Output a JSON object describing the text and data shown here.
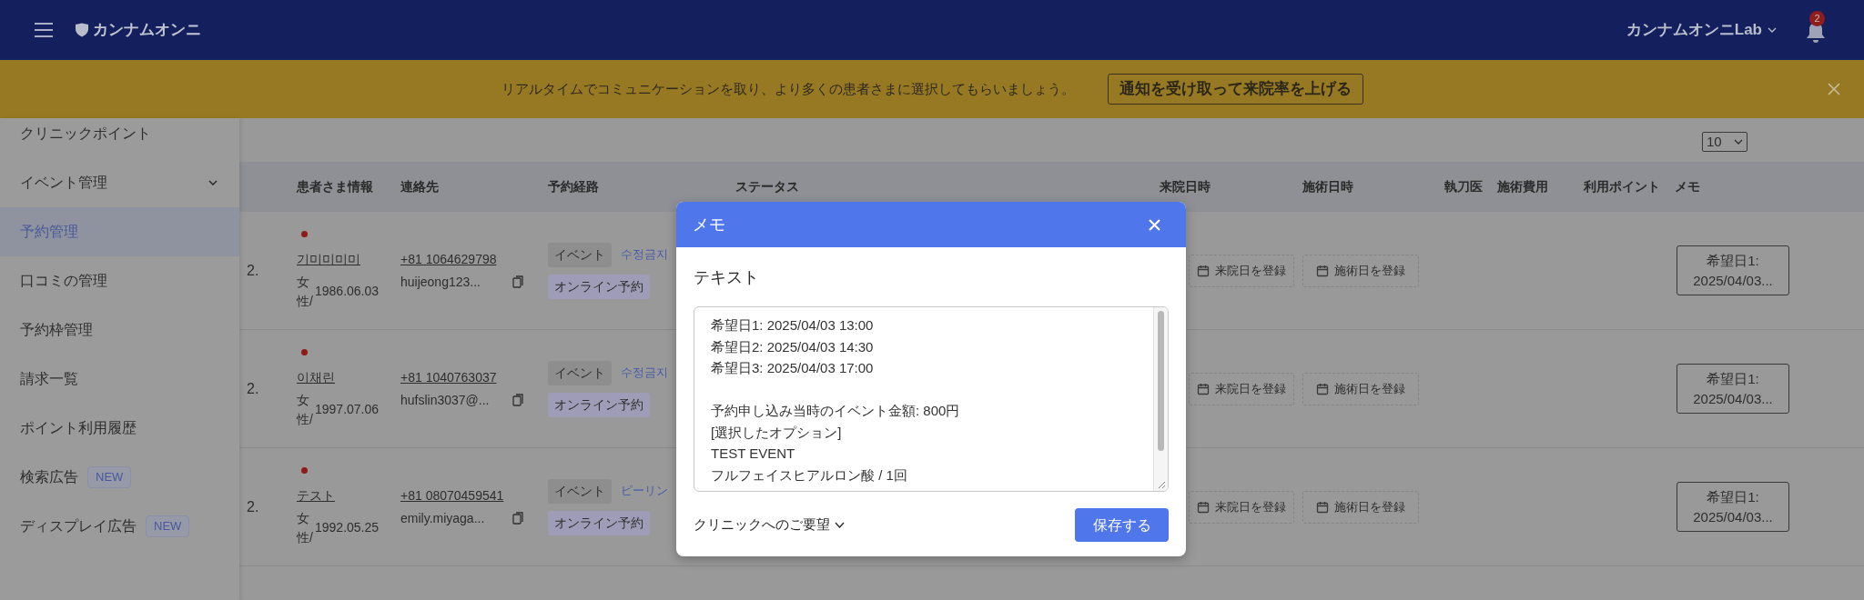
{
  "header": {
    "logo": "カンナムオンニ",
    "account": "カンナムオンニLab",
    "notification_count": "2"
  },
  "banner": {
    "message": "リアルタイムでコミュニケーションを取り、より多くの患者さまに選択してもらいましょう。",
    "button": "通知を受け取って来院率を上げる"
  },
  "sidebar": {
    "items": [
      {
        "label": "クリニックポイント",
        "kind": "link",
        "selected": false
      },
      {
        "label": "イベント管理",
        "kind": "group",
        "selected": false
      },
      {
        "label": "予約管理",
        "kind": "link",
        "selected": true
      },
      {
        "label": "口コミの管理",
        "kind": "link",
        "selected": false
      },
      {
        "label": "予約枠管理",
        "kind": "link",
        "selected": false
      },
      {
        "label": "請求一覧",
        "kind": "link",
        "selected": false
      },
      {
        "label": "ポイント利用履歴",
        "kind": "link",
        "selected": false
      },
      {
        "label": "検索広告",
        "kind": "link",
        "selected": false,
        "badge": "NEW"
      },
      {
        "label": "ディスプレイ広告",
        "kind": "link",
        "selected": false,
        "badge": "NEW"
      }
    ]
  },
  "page_size": "10",
  "table": {
    "columns": [
      "患者さま情報",
      "連絡先",
      "予約経路",
      "ステータス",
      "来院日時",
      "施術日時",
      "執刀医",
      "施術費用",
      "利用ポイント",
      "メモ"
    ],
    "rows": [
      {
        "column_1": "2.",
        "name": "기미미미미",
        "gender": "女性/",
        "birthdate": "1986.06.03",
        "phone": "+81 1064629798",
        "email": "huijeong123...",
        "tags": [
          {
            "label": "イベント",
            "kind": "source"
          },
          {
            "label": "オンライン予約",
            "kind": "channel"
          }
        ],
        "event": "수정금지",
        "visit_button": "来院日を登録",
        "treatment_button": "施術日を登録",
        "memo": "希望日1: 2025/04/03..."
      },
      {
        "column_1": "2.",
        "name": "이채린",
        "gender": "女性/",
        "birthdate": "1997.07.06",
        "phone": "+81 1040763037",
        "email": "hufslin3037@...",
        "tags": [
          {
            "label": "イベント",
            "kind": "source"
          },
          {
            "label": "オンライン予約",
            "kind": "channel"
          }
        ],
        "event": "수정금지",
        "visit_button": "来院日を登録",
        "treatment_button": "施術日を登録",
        "memo": "希望日1: 2025/04/03..."
      },
      {
        "column_1": "2.",
        "name": "テスト",
        "gender": "女性/",
        "birthdate": "1992.05.25",
        "phone": "+81 08070459541",
        "email": "emily.miyaga...",
        "tags": [
          {
            "label": "イベント",
            "kind": "source"
          },
          {
            "label": "オンライン予約",
            "kind": "channel"
          }
        ],
        "event": "ピーリン",
        "visit_button": "来院日を登録",
        "treatment_button": "施術日を登録",
        "memo": "希望日1: 2025/04/03..."
      }
    ]
  },
  "modal": {
    "title": "メモ",
    "label": "テキスト",
    "text": "希望日1: 2025/04/03 13:00\n希望日2: 2025/04/03 14:30\n希望日3: 2025/04/03 17:00\n\n予約申し込み当時のイベント金額: 800円\n[選択したオプション]\nTEST EVENT\nフルフェイスヒアルロン酸 / 1回",
    "request_toggle": "クリニックへのご要望",
    "save_button": "保存する"
  }
}
